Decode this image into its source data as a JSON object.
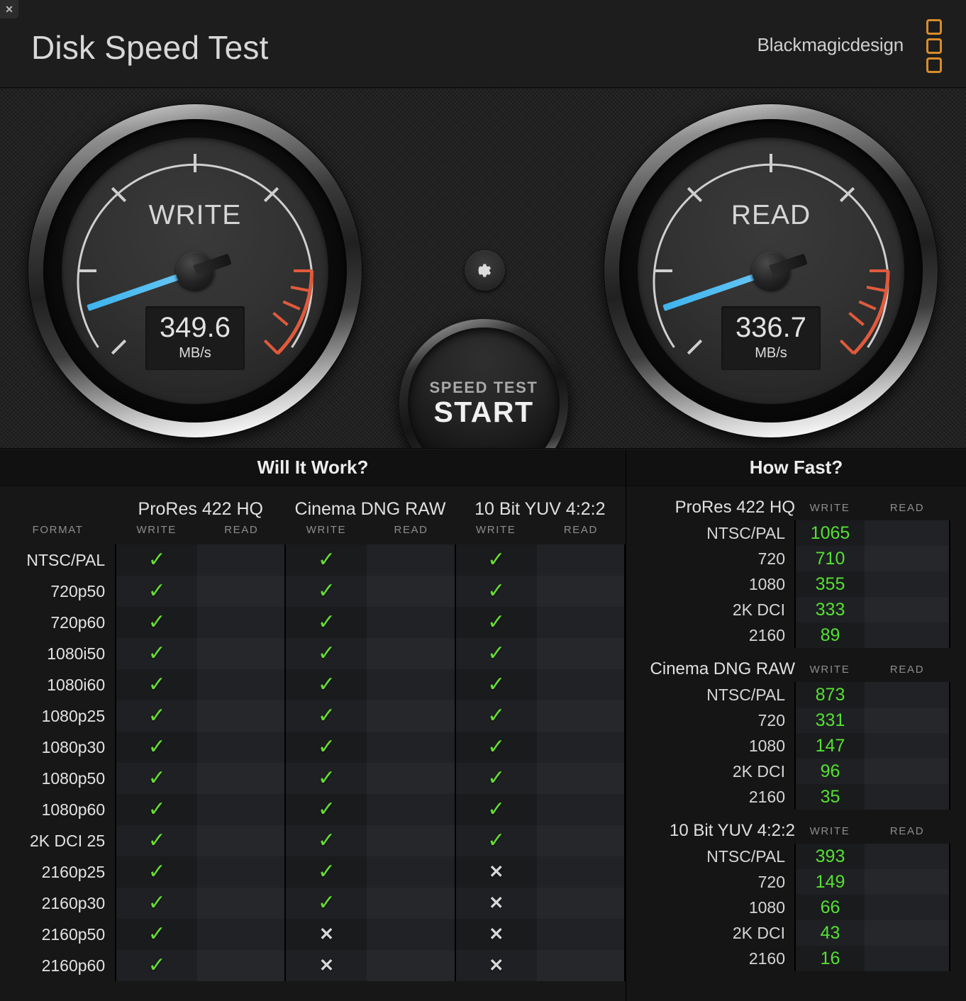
{
  "window": {
    "close_label": "✕"
  },
  "header": {
    "title": "Disk Speed Test",
    "brand": "Blackmagicdesign",
    "logo_icon": "blackmagic-logo-icon",
    "accent_color": "#d88c2a"
  },
  "gauges": {
    "write": {
      "label": "WRITE",
      "value": "349.6",
      "unit": "MB/s",
      "angle_deg": -19
    },
    "read": {
      "label": "READ",
      "value": "336.7",
      "unit": "MB/s",
      "angle_deg": -19
    },
    "needle_color": "#57bff2",
    "redline_color": "#e05a3c"
  },
  "controls": {
    "gear_icon": "gear-icon",
    "start_small": "SPEED TEST",
    "start_big": "START"
  },
  "will_it_work": {
    "title": "Will It Work?",
    "format_header": "FORMAT",
    "codecs": [
      "ProRes 422 HQ",
      "Cinema DNG RAW",
      "10 Bit YUV 4:2:2"
    ],
    "sub_headers": [
      "WRITE",
      "READ"
    ],
    "ok_glyph": "✓",
    "no_glyph": "✕",
    "rows": [
      {
        "format": "NTSC/PAL",
        "cells": [
          [
            "ok",
            ""
          ],
          [
            "ok",
            ""
          ],
          [
            "ok",
            ""
          ]
        ]
      },
      {
        "format": "720p50",
        "cells": [
          [
            "ok",
            ""
          ],
          [
            "ok",
            ""
          ],
          [
            "ok",
            ""
          ]
        ]
      },
      {
        "format": "720p60",
        "cells": [
          [
            "ok",
            ""
          ],
          [
            "ok",
            ""
          ],
          [
            "ok",
            ""
          ]
        ]
      },
      {
        "format": "1080i50",
        "cells": [
          [
            "ok",
            ""
          ],
          [
            "ok",
            ""
          ],
          [
            "ok",
            ""
          ]
        ]
      },
      {
        "format": "1080i60",
        "cells": [
          [
            "ok",
            ""
          ],
          [
            "ok",
            ""
          ],
          [
            "ok",
            ""
          ]
        ]
      },
      {
        "format": "1080p25",
        "cells": [
          [
            "ok",
            ""
          ],
          [
            "ok",
            ""
          ],
          [
            "ok",
            ""
          ]
        ]
      },
      {
        "format": "1080p30",
        "cells": [
          [
            "ok",
            ""
          ],
          [
            "ok",
            ""
          ],
          [
            "ok",
            ""
          ]
        ]
      },
      {
        "format": "1080p50",
        "cells": [
          [
            "ok",
            ""
          ],
          [
            "ok",
            ""
          ],
          [
            "ok",
            ""
          ]
        ]
      },
      {
        "format": "1080p60",
        "cells": [
          [
            "ok",
            ""
          ],
          [
            "ok",
            ""
          ],
          [
            "ok",
            ""
          ]
        ]
      },
      {
        "format": "2K DCI 25",
        "cells": [
          [
            "ok",
            ""
          ],
          [
            "ok",
            ""
          ],
          [
            "ok",
            ""
          ]
        ]
      },
      {
        "format": "2160p25",
        "cells": [
          [
            "ok",
            ""
          ],
          [
            "ok",
            ""
          ],
          [
            "no",
            ""
          ]
        ]
      },
      {
        "format": "2160p30",
        "cells": [
          [
            "ok",
            ""
          ],
          [
            "ok",
            ""
          ],
          [
            "no",
            ""
          ]
        ]
      },
      {
        "format": "2160p50",
        "cells": [
          [
            "ok",
            ""
          ],
          [
            "no",
            ""
          ],
          [
            "no",
            ""
          ]
        ]
      },
      {
        "format": "2160p60",
        "cells": [
          [
            "ok",
            ""
          ],
          [
            "no",
            ""
          ],
          [
            "no",
            ""
          ]
        ]
      }
    ]
  },
  "how_fast": {
    "title": "How Fast?",
    "write_header": "WRITE",
    "read_header": "READ",
    "groups": [
      {
        "name": "ProRes 422 HQ",
        "rows": [
          {
            "res": "NTSC/PAL",
            "write": "1065",
            "read": ""
          },
          {
            "res": "720",
            "write": "710",
            "read": ""
          },
          {
            "res": "1080",
            "write": "355",
            "read": ""
          },
          {
            "res": "2K DCI",
            "write": "333",
            "read": ""
          },
          {
            "res": "2160",
            "write": "89",
            "read": ""
          }
        ]
      },
      {
        "name": "Cinema DNG RAW",
        "rows": [
          {
            "res": "NTSC/PAL",
            "write": "873",
            "read": ""
          },
          {
            "res": "720",
            "write": "331",
            "read": ""
          },
          {
            "res": "1080",
            "write": "147",
            "read": ""
          },
          {
            "res": "2K DCI",
            "write": "96",
            "read": ""
          },
          {
            "res": "2160",
            "write": "35",
            "read": ""
          }
        ]
      },
      {
        "name": "10 Bit YUV 4:2:2",
        "rows": [
          {
            "res": "NTSC/PAL",
            "write": "393",
            "read": ""
          },
          {
            "res": "720",
            "write": "149",
            "read": ""
          },
          {
            "res": "1080",
            "write": "66",
            "read": ""
          },
          {
            "res": "2K DCI",
            "write": "43",
            "read": ""
          },
          {
            "res": "2160",
            "write": "16",
            "read": ""
          }
        ]
      }
    ],
    "value_color": "#55e033"
  }
}
